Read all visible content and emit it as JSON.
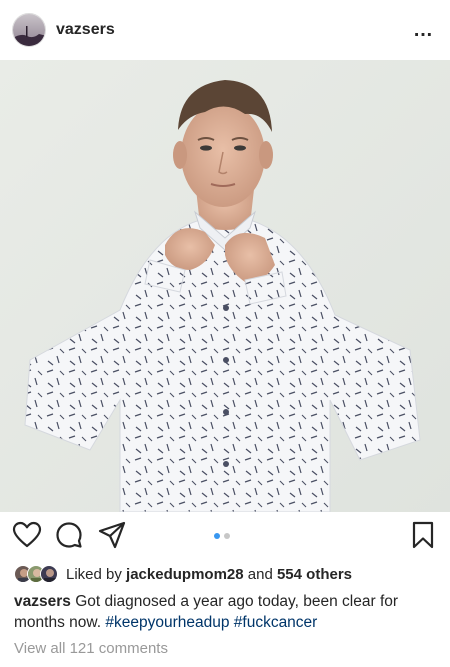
{
  "post": {
    "username": "vazsers",
    "more_icon": "…",
    "photo_alt": "photo"
  },
  "carousel": {
    "count": 2,
    "active_index": 0
  },
  "likes": {
    "prefix": "Liked by",
    "liker": "jackedupmom28",
    "connector": "and",
    "others": "554 others"
  },
  "caption": {
    "username": "vazsers",
    "text": "Got diagnosed a year ago today, been clear for months now.",
    "hashtags": [
      "#keepyourheadup",
      "#fuckcancer"
    ]
  },
  "comments": {
    "view_all_label": "View all 121 comments"
  },
  "colors": {
    "text": "#262626",
    "hashtag": "#003569",
    "muted": "#999999",
    "carousel_active": "#3897f0",
    "carousel_inactive": "#c7c7c7"
  },
  "icons": {
    "like": "heart-icon",
    "comment": "comment-bubble-icon",
    "share": "paper-plane-icon",
    "save": "bookmark-icon",
    "more": "more-dots-icon"
  }
}
